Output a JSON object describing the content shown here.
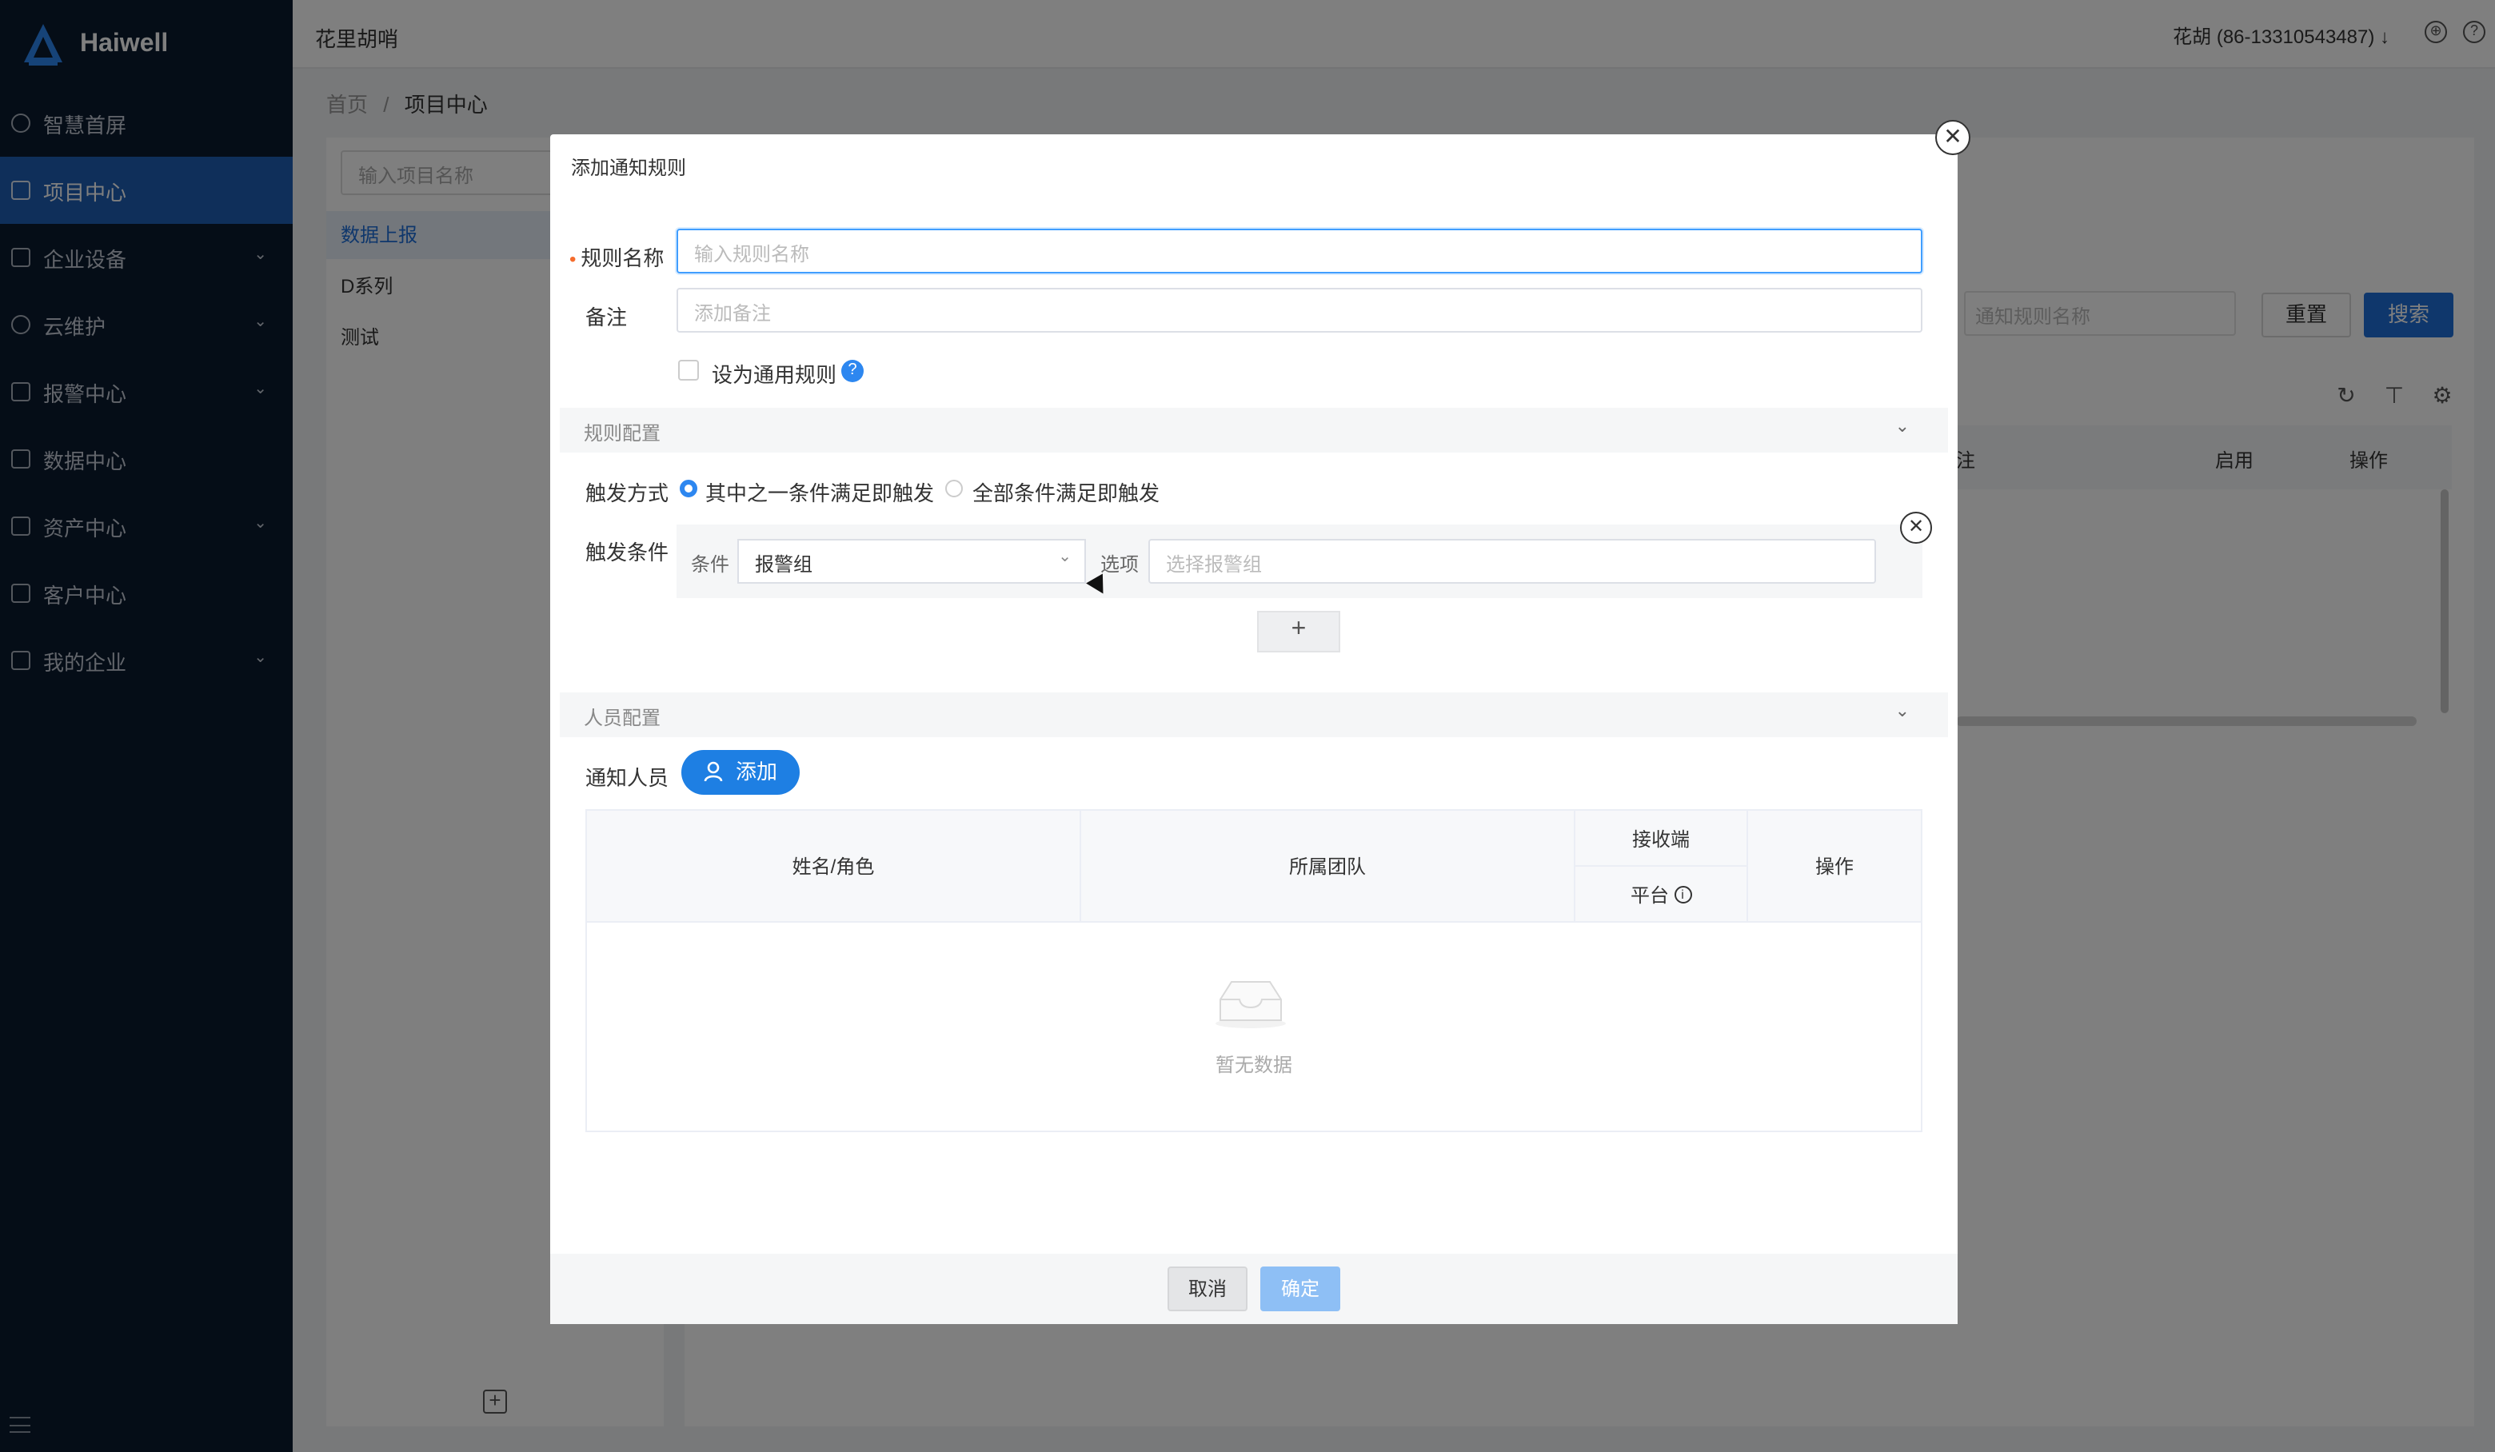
{
  "brand": {
    "name": "Haiwell"
  },
  "sidebar": {
    "items": [
      {
        "label": "智慧首屏",
        "chevron": false,
        "active": false
      },
      {
        "label": "项目中心",
        "chevron": false,
        "active": true
      },
      {
        "label": "企业设备",
        "chevron": true,
        "active": false
      },
      {
        "label": "云维护",
        "chevron": true,
        "active": false
      },
      {
        "label": "报警中心",
        "chevron": true,
        "active": false
      },
      {
        "label": "数据中心",
        "chevron": false,
        "active": false
      },
      {
        "label": "资产中心",
        "chevron": true,
        "active": false
      },
      {
        "label": "客户中心",
        "chevron": false,
        "active": false
      },
      {
        "label": "我的企业",
        "chevron": true,
        "active": false
      }
    ]
  },
  "header": {
    "app_name": "花里胡哨",
    "user": "花胡 (86-13310543487) ↓"
  },
  "breadcrumb": {
    "home": "首页",
    "sep": "/",
    "current": "项目中心"
  },
  "projects": {
    "search_placeholder": "输入项目名称",
    "items": [
      "数据上报",
      "D系列",
      "测试"
    ]
  },
  "background": {
    "search_placeholder": "通知规则名称",
    "reset_label": "重置",
    "search_label": "搜索",
    "columns": [
      "注",
      "启用",
      "操作"
    ]
  },
  "modal": {
    "title": "添加通知规则",
    "rule_name_label": "规则名称",
    "rule_name_placeholder": "输入规则名称",
    "remark_label": "备注",
    "remark_placeholder": "添加备注",
    "general_rule_label": "设为通用规则",
    "rule_config_title": "规则配置",
    "trigger_mode_label": "触发方式",
    "trigger_any": "其中之一条件满足即触发",
    "trigger_all": "全部条件满足即触发",
    "trigger_condition_label": "触发条件",
    "condition_label": "条件",
    "condition_value": "报警组",
    "option_label": "选项",
    "option_placeholder": "选择报警组",
    "plus_label": "+",
    "people_config_title": "人员配置",
    "notify_people_label": "通知人员",
    "add_label": "添加",
    "table": {
      "col_name": "姓名/角色",
      "col_team": "所属团队",
      "col_receiver": "接收端",
      "col_platform": "平台",
      "col_action": "操作",
      "empty_text": "暂无数据"
    },
    "cancel_label": "取消",
    "ok_label": "确定"
  },
  "colors": {
    "accent": "#1e7fe3",
    "sidebar_bg": "#0b1a2e",
    "active_menu": "#1e5fb4"
  }
}
